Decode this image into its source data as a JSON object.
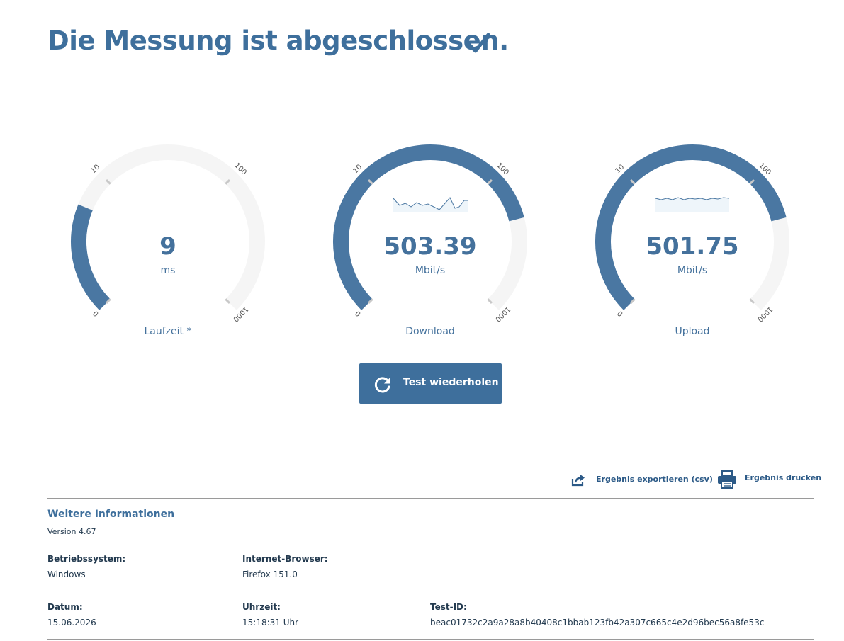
{
  "header": {
    "title": "Die Messung ist abgeschlossen."
  },
  "colors": {
    "accent": "#3e6f9c",
    "gauge_fill": "#4a77a2",
    "gauge_track": "#f5f5f5",
    "text_dark": "#233a4f"
  },
  "gauges": [
    {
      "value": "9",
      "unit": "ms",
      "label": "Laufzeit *",
      "ticks": [
        "0",
        "10",
        "100",
        "1000"
      ],
      "fill_fraction": 0.25
    },
    {
      "value": "503.39",
      "unit": "Mbit/s",
      "label": "Download",
      "ticks": [
        "0",
        "10",
        "100",
        "1000"
      ],
      "fill_fraction": 0.78
    },
    {
      "value": "501.75",
      "unit": "Mbit/s",
      "label": "Upload",
      "ticks": [
        "0",
        "10",
        "100",
        "1000"
      ],
      "fill_fraction": 0.78
    }
  ],
  "actions": {
    "repeat_label": "Test wiederholen",
    "export_label": "Ergebnis exportieren (csv)",
    "print_label": "Ergebnis drucken"
  },
  "info": {
    "heading": "Weitere Informationen",
    "version": "Version 4.67",
    "os_label": "Betriebssystem:",
    "os_value": "Windows",
    "browser_label": "Internet-Browser:",
    "browser_value": "Firefox 151.0",
    "date_label": "Datum:",
    "date_value": "15.06.2026",
    "time_label": "Uhrzeit:",
    "time_value": "15:18:31 Uhr",
    "testid_label": "Test-ID:",
    "testid_value": "beac01732c2a9a28a8b40408c1bbab123fb42a307c665c4e2d96bec56a8fe53c"
  }
}
